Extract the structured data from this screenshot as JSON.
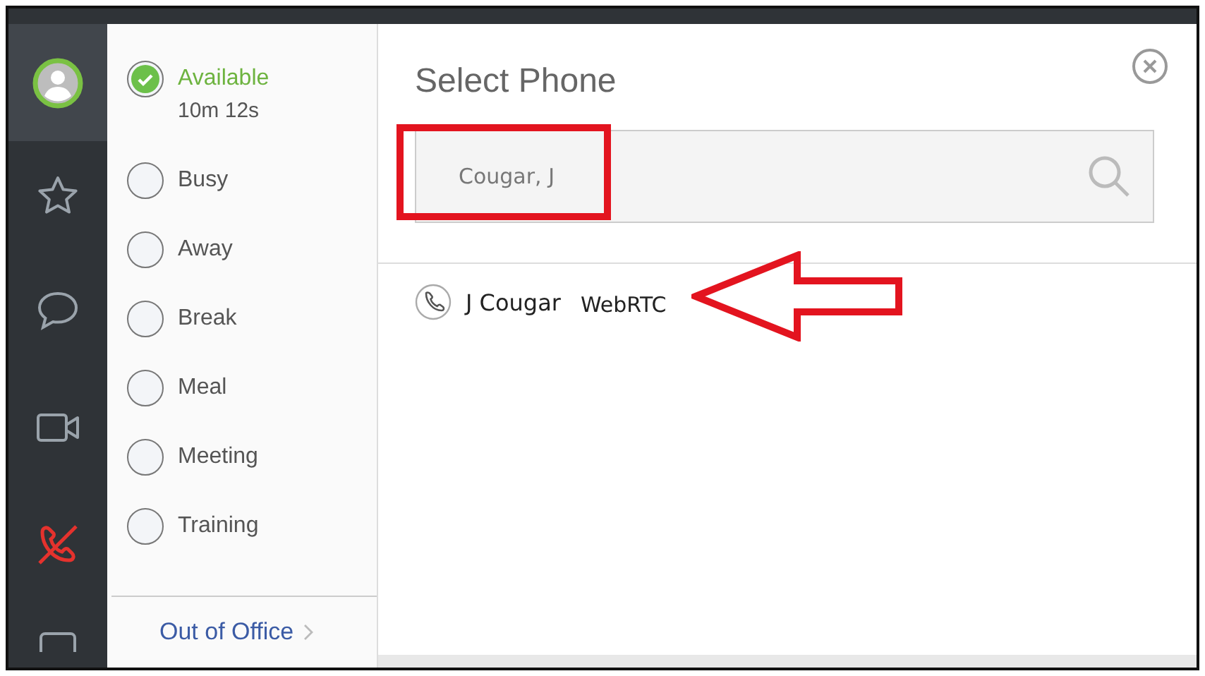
{
  "rail": {
    "items": [
      {
        "kind": "avatar",
        "selected": true
      },
      {
        "kind": "star",
        "selected": false
      },
      {
        "kind": "chat",
        "selected": false
      },
      {
        "kind": "video",
        "selected": false
      },
      {
        "kind": "phone-off",
        "selected": false
      },
      {
        "kind": "screen",
        "selected": false
      }
    ]
  },
  "statuses": [
    {
      "label": "Available",
      "detail": "10m 12s",
      "selected": true
    },
    {
      "label": "Busy",
      "selected": false
    },
    {
      "label": "Away",
      "selected": false
    },
    {
      "label": "Break",
      "selected": false
    },
    {
      "label": "Meal",
      "selected": false
    },
    {
      "label": "Meeting",
      "selected": false
    },
    {
      "label": "Training",
      "selected": false
    }
  ],
  "out_of_office": {
    "label": "Out of Office"
  },
  "dialog": {
    "title": "Select Phone",
    "search": {
      "value": "Cougar, J"
    },
    "results": [
      {
        "name": "J Cougar",
        "type": "WebRTC"
      }
    ]
  },
  "annotations": {
    "search_highlight": true,
    "result_arrow": true
  }
}
